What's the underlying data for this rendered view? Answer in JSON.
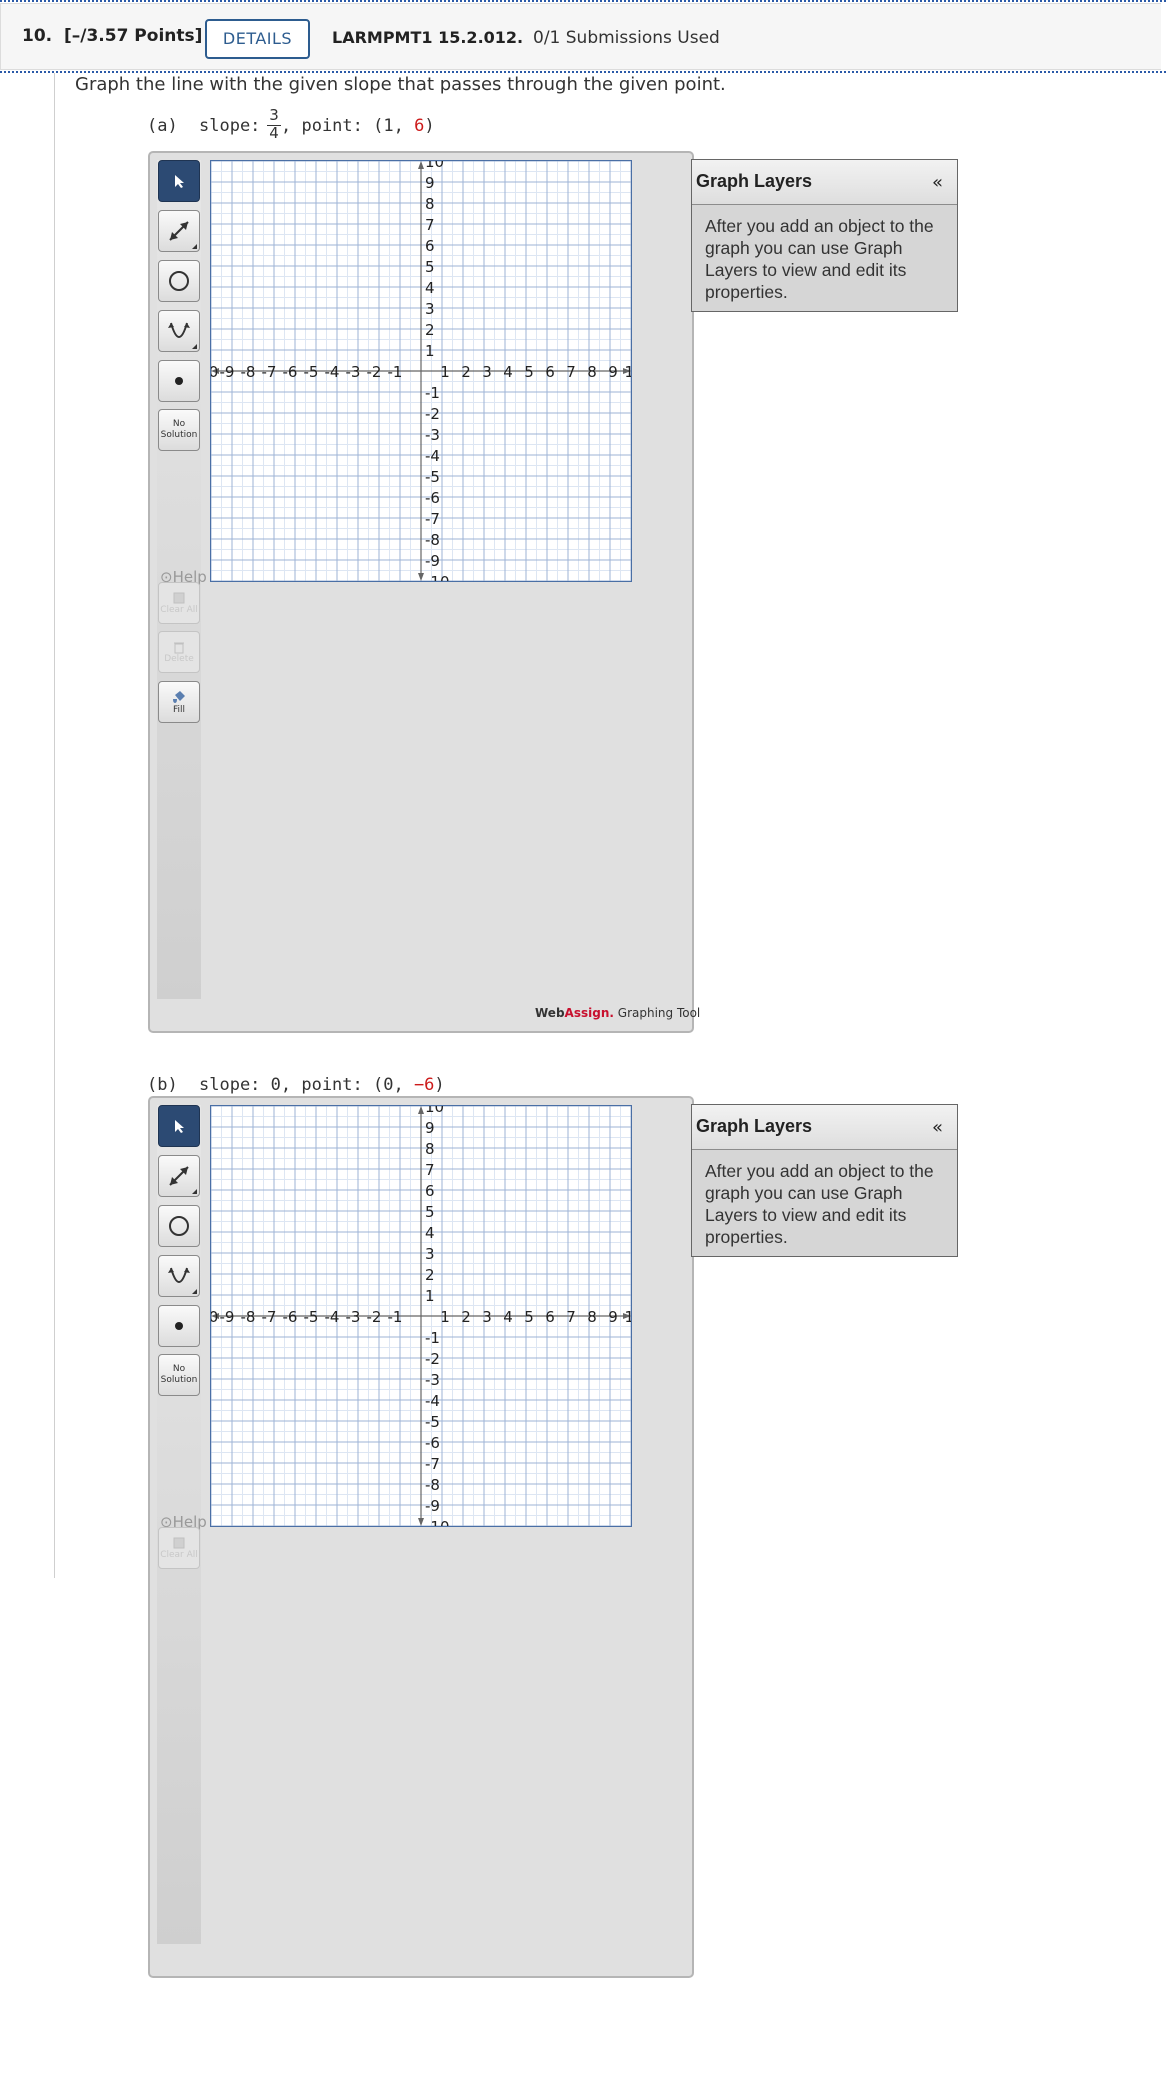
{
  "header": {
    "question_number": "10.",
    "points": "[–/3.57 Points]",
    "details_label": "DETAILS",
    "problem_code": "LARMPMT1 15.2.012.",
    "submissions": "0/1 Submissions Used"
  },
  "prompt": "Graph the line with the given slope that passes through the given point.",
  "parts": [
    {
      "label": "(a)",
      "slope_text": "slope:",
      "slope_numerator": "3",
      "slope_denominator": "4",
      "point_prefix": ", point: (1, ",
      "point_highlight": "6",
      "point_suffix": ")"
    },
    {
      "label": "(b)",
      "slope_text": "slope: 0, point: (0, ",
      "point_highlight": "−6",
      "point_suffix": ")"
    }
  ],
  "toolbar": {
    "no_solution": "No Solution",
    "help": "Help",
    "clear_all": "Clear All",
    "delete": "Delete",
    "fill": "Fill"
  },
  "graph": {
    "x_min": -10,
    "x_max": 10,
    "y_min": -10,
    "y_max": 10,
    "grid_step": 1,
    "grid": true
  },
  "layers_panel": {
    "title": "Graph Layers",
    "collapse": "«",
    "body": "After you add an object to the graph you can use Graph Layers to view and edit its properties."
  },
  "brand": {
    "web": "Web",
    "assign": "Assign.",
    "tool": "Graphing Tool"
  }
}
